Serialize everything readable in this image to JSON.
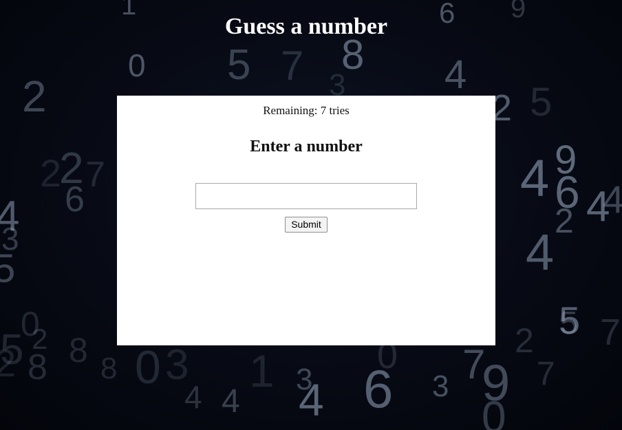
{
  "page": {
    "title": "Guess a number"
  },
  "game": {
    "remaining_text": "Remaining: 7 tries",
    "prompt": "Enter a number",
    "input_value": "",
    "input_placeholder": "",
    "submit_label": "Submit"
  },
  "background": {
    "digits": [
      "1",
      "6",
      "9",
      "0",
      "5",
      "7",
      "8",
      "3",
      "2",
      "4",
      "2",
      "5",
      "2",
      "7",
      "2",
      "4",
      "9",
      "6",
      "4",
      "4",
      "2",
      "6",
      "4",
      "3",
      "5",
      "4",
      "5",
      "0",
      "2",
      "5",
      "2",
      "8",
      "8",
      "0",
      "3",
      "1",
      "0",
      "8",
      "6",
      "3",
      "7",
      "9",
      "7",
      "0",
      "4",
      "3",
      "4",
      "4",
      "2",
      "5",
      "7"
    ]
  },
  "colors": {
    "background": "#070a14",
    "card": "#ffffff",
    "title": "#ffffff"
  }
}
